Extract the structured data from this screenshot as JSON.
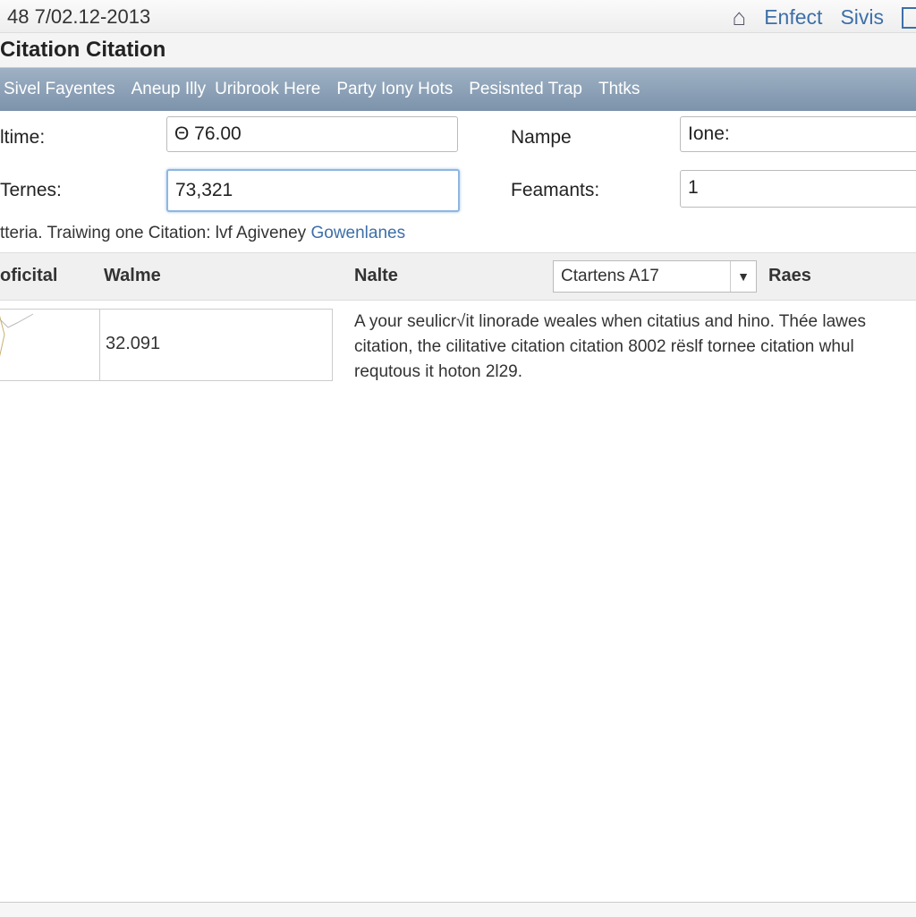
{
  "topbar": {
    "datetime": "48 7/02.12-2013",
    "links": [
      "Enfect",
      "Sivis"
    ],
    "icons": [
      "home-icon",
      "panel-icon"
    ]
  },
  "title": "Citation Citation",
  "nav": [
    "Sivel Fayentes",
    "Aneup Illy",
    "Uribrook Here",
    "Party Iony Hots",
    "Pesisnted Trap",
    "Thtks"
  ],
  "form": {
    "time_label": "ltime:",
    "time_value": "Θ 76.00",
    "name_label": "Nampe",
    "name_value": "Ione:",
    "terms_label": "Ternes:",
    "terms_value": "73,321",
    "feamants_label": "Feamants:",
    "feamants_value": "1"
  },
  "hint": {
    "text": "tteria. Traiwing one Citation: lvf Agiveney ",
    "link": "Gowenlanes"
  },
  "table": {
    "headers": [
      "oficital",
      "Walme",
      "Nalte",
      "Raes"
    ],
    "select_value": "Ctartens A17",
    "row": {
      "value": "32.091",
      "description": "A your seulicr√it linorade weales when citatius and hino. Thée lawes citation, the cilitative citation citation 8002 rëslf tornee citation whul requtous it hoton 2l29."
    }
  },
  "colors": {
    "accent": "#3d6fa8",
    "nav_bg": "#8aa0b7"
  }
}
